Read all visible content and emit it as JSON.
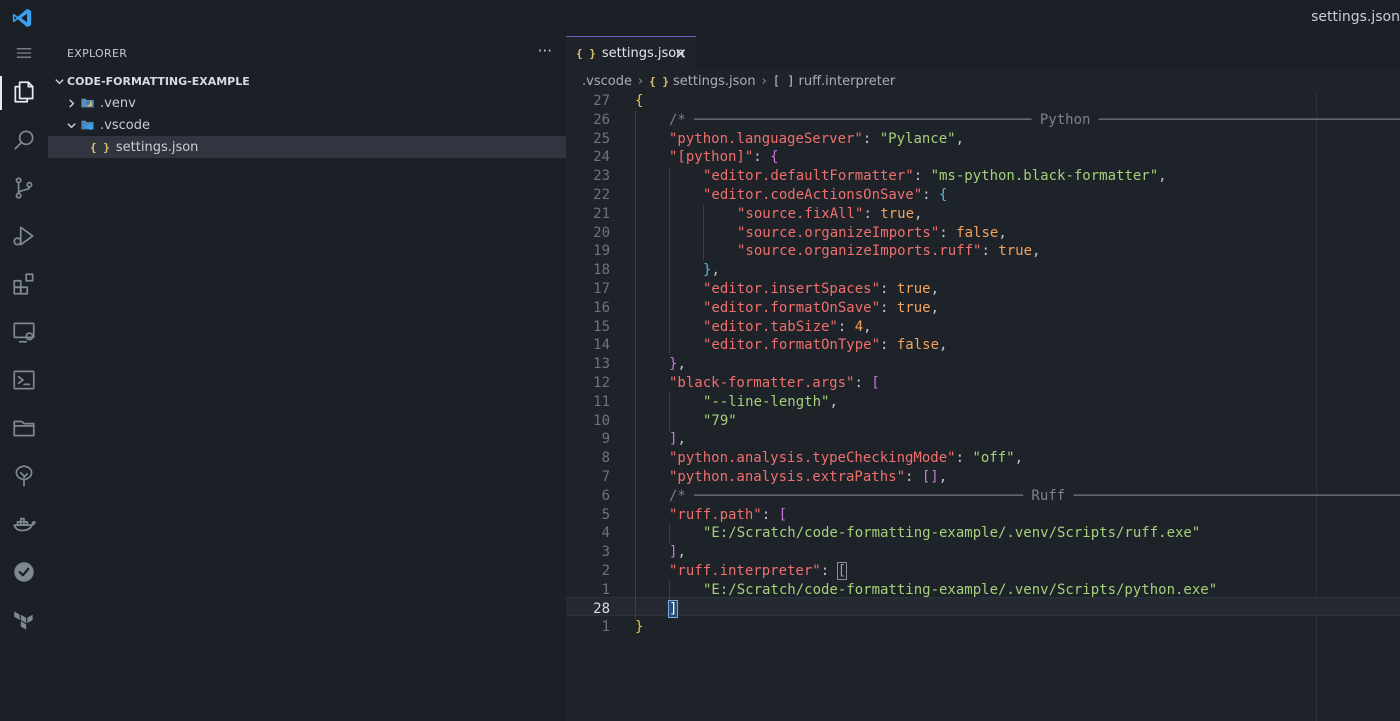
{
  "window": {
    "title": "settings.json"
  },
  "activity_bar": [
    {
      "name": "explorer-icon",
      "active": true
    },
    {
      "name": "search-icon"
    },
    {
      "name": "source-control-icon"
    },
    {
      "name": "run-debug-icon"
    },
    {
      "name": "extensions-icon"
    },
    {
      "name": "remote-explorer-icon"
    },
    {
      "name": "terminal-icon"
    },
    {
      "name": "folder-icon"
    },
    {
      "name": "tree-icon"
    },
    {
      "name": "docker-icon"
    },
    {
      "name": "check-circle-icon"
    },
    {
      "name": "terraform-icon"
    }
  ],
  "sidebar": {
    "header": "EXPLORER",
    "more": "···",
    "folder": "CODE-FORMATTING-EXAMPLE",
    "items": [
      {
        "label": ".venv",
        "expanded": false
      },
      {
        "label": ".vscode",
        "expanded": true
      },
      {
        "label": "settings.json",
        "icon": "{ }",
        "selected": true
      }
    ]
  },
  "tab": {
    "icon": "{ }",
    "label": "settings.json",
    "close": "✕"
  },
  "breadcrumb": [
    ".vscode",
    "settings.json",
    "ruff.interpreter"
  ],
  "breadcrumb_icons": {
    "json": "{ }",
    "array": "[ ]"
  },
  "colors": {
    "accent": "#7b5bc9",
    "key": "#ef6f6c",
    "string": "#a5d17a",
    "literal": "#f5a35b",
    "comment": "#7b828c"
  },
  "editor": {
    "line_numbers": [
      "27",
      "26",
      "25",
      "24",
      "23",
      "22",
      "21",
      "20",
      "19",
      "18",
      "17",
      "16",
      "15",
      "14",
      "13",
      "12",
      "11",
      "10",
      "9",
      "8",
      "7",
      "6",
      "5",
      "4",
      "3",
      "2",
      "1",
      "28",
      "1"
    ],
    "current_line_number": "28",
    "lines": [
      [
        [
          "br1",
          "{"
        ]
      ],
      [
        [
          "c",
          "/* ──────────────────────────────────────── Python ────────────────────────────────────── */"
        ]
      ],
      [
        [
          "k",
          "\"python.languageServer\""
        ],
        [
          "p",
          ": "
        ],
        [
          "s",
          "\"Pylance\""
        ],
        [
          "p",
          ","
        ]
      ],
      [
        [
          "k",
          "\"[python]\""
        ],
        [
          "p",
          ": "
        ],
        [
          "br2",
          "{"
        ]
      ],
      [
        [
          "k",
          "\"editor.defaultFormatter\""
        ],
        [
          "p",
          ": "
        ],
        [
          "s",
          "\"ms-python.black-formatter\""
        ],
        [
          "p",
          ","
        ]
      ],
      [
        [
          "k",
          "\"editor.codeActionsOnSave\""
        ],
        [
          "p",
          ": "
        ],
        [
          "br3",
          "{"
        ]
      ],
      [
        [
          "k",
          "\"source.fixAll\""
        ],
        [
          "p",
          ": "
        ],
        [
          "b",
          "true"
        ],
        [
          "p",
          ","
        ]
      ],
      [
        [
          "k",
          "\"source.organizeImports\""
        ],
        [
          "p",
          ": "
        ],
        [
          "b",
          "false"
        ],
        [
          "p",
          ","
        ]
      ],
      [
        [
          "k",
          "\"source.organizeImports.ruff\""
        ],
        [
          "p",
          ": "
        ],
        [
          "b",
          "true"
        ],
        [
          "p",
          ","
        ]
      ],
      [
        [
          "br3",
          "}"
        ],
        [
          "p",
          ","
        ]
      ],
      [
        [
          "k",
          "\"editor.insertSpaces\""
        ],
        [
          "p",
          ": "
        ],
        [
          "b",
          "true"
        ],
        [
          "p",
          ","
        ]
      ],
      [
        [
          "k",
          "\"editor.formatOnSave\""
        ],
        [
          "p",
          ": "
        ],
        [
          "b",
          "true"
        ],
        [
          "p",
          ","
        ]
      ],
      [
        [
          "k",
          "\"editor.tabSize\""
        ],
        [
          "p",
          ": "
        ],
        [
          "n",
          "4"
        ],
        [
          "p",
          ","
        ]
      ],
      [
        [
          "k",
          "\"editor.formatOnType\""
        ],
        [
          "p",
          ": "
        ],
        [
          "b",
          "false"
        ],
        [
          "p",
          ","
        ]
      ],
      [
        [
          "br2",
          "}"
        ],
        [
          "p",
          ","
        ]
      ],
      [
        [
          "k",
          "\"black-formatter.args\""
        ],
        [
          "p",
          ": "
        ],
        [
          "br2",
          "["
        ]
      ],
      [
        [
          "s",
          "\"--line-length\""
        ],
        [
          "p",
          ","
        ]
      ],
      [
        [
          "s",
          "\"79\""
        ]
      ],
      [
        [
          "br2",
          "]"
        ],
        [
          "p",
          ","
        ]
      ],
      [
        [
          "k",
          "\"python.analysis.typeCheckingMode\""
        ],
        [
          "p",
          ": "
        ],
        [
          "s",
          "\"off\""
        ],
        [
          "p",
          ","
        ]
      ],
      [
        [
          "k",
          "\"python.analysis.extraPaths\""
        ],
        [
          "p",
          ": "
        ],
        [
          "br2",
          "[]"
        ],
        [
          "p",
          ","
        ]
      ],
      [
        [
          "c",
          "/* ─────────────────────────────────────── Ruff ──────────────────────────────────────── */"
        ]
      ],
      [
        [
          "k",
          "\"ruff.path\""
        ],
        [
          "p",
          ": "
        ],
        [
          "br2",
          "["
        ]
      ],
      [
        [
          "s",
          "\"E:/Scratch/code-formatting-example/.venv/Scripts/ruff.exe\""
        ]
      ],
      [
        [
          "br2",
          "]"
        ],
        [
          "p",
          ","
        ]
      ],
      [
        [
          "k",
          "\"ruff.interpreter\""
        ],
        [
          "p",
          ": "
        ],
        [
          "br2 bm",
          "["
        ]
      ],
      [
        [
          "s",
          "\"E:/Scratch/code-formatting-example/.venv/Scripts/python.exe\""
        ]
      ],
      [
        [
          "sel",
          "]"
        ]
      ],
      [
        [
          "br1",
          "}"
        ]
      ]
    ],
    "indent": [
      0,
      1,
      1,
      1,
      2,
      2,
      3,
      3,
      3,
      2,
      2,
      2,
      2,
      2,
      1,
      1,
      2,
      2,
      1,
      1,
      1,
      1,
      1,
      2,
      1,
      1,
      2,
      1,
      0
    ]
  }
}
